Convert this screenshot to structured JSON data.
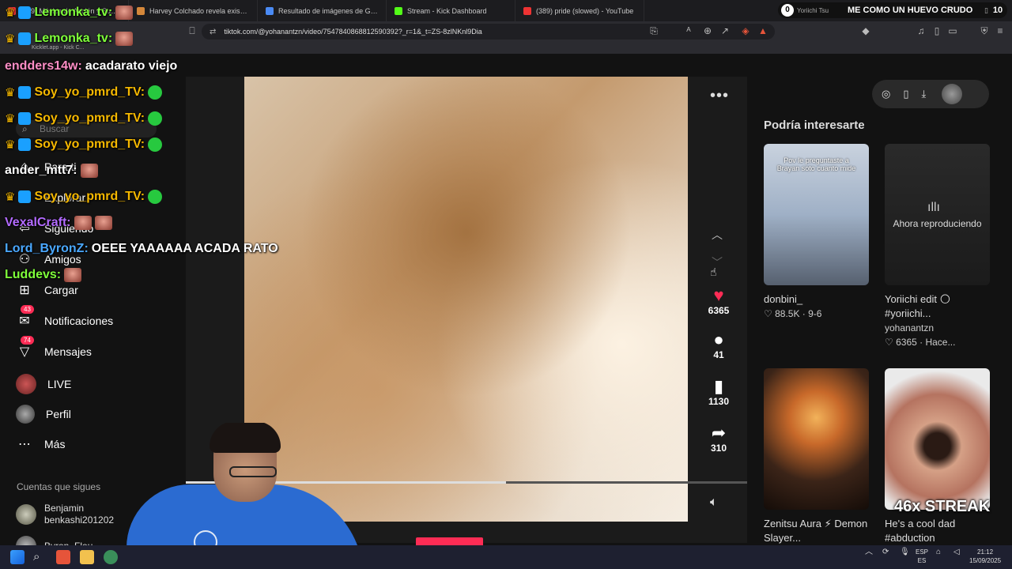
{
  "browser": {
    "tabs": [
      {
        "label": "(389) Música de Acción y Suspenso",
        "color": "#e33"
      },
      {
        "label": "Harvey Colchado revela existencia d",
        "color": "#d4873a"
      },
      {
        "label": "Resultado de imágenes de Google",
        "color": "#4a8af4"
      },
      {
        "label": "Stream - Kick Dashboard",
        "color": "#53fc18"
      },
      {
        "label": "(389) pride (slowed) - YouTube",
        "color": "#e33"
      },
      {
        "label": "Yoriichi Tsu",
        "color": "#ddd"
      }
    ],
    "tab_count": "10",
    "url": "tiktok.com/@yohanantzn/video/7547840868812590392?_r=1&_t=ZS-8zlNKnl9Dia",
    "bookmark": "Kicklet.app - Kick C..."
  },
  "overlay_banner": {
    "left_num": "0",
    "text": "ME COMO UN HUEVO CRUDO",
    "right_num": "10"
  },
  "sidebar": {
    "search_placeholder": "Buscar",
    "items": [
      {
        "label": "Para ti",
        "icon": "home-icon"
      },
      {
        "label": "Explorar",
        "icon": "compass-icon"
      },
      {
        "label": "Siguiendo",
        "icon": "following-icon"
      },
      {
        "label": "Amigos",
        "icon": "friends-icon"
      },
      {
        "label": "Cargar",
        "icon": "upload-icon"
      },
      {
        "label": "Notificaciones",
        "icon": "bell-icon",
        "badge": "43"
      },
      {
        "label": "Mensajes",
        "icon": "paper-plane-icon",
        "badge": "74"
      },
      {
        "label": "LIVE",
        "icon": "live-icon"
      },
      {
        "label": "Perfil",
        "icon": "profile-icon"
      },
      {
        "label": "Más",
        "icon": "more-icon"
      }
    ],
    "following_title": "Cuentas que sigues",
    "following": [
      {
        "name": "Benjamin",
        "handle": "benkashi201202"
      },
      {
        "name": "Byron_Flou",
        "handle": ""
      }
    ]
  },
  "video": {
    "likes": "6365",
    "comments": "41",
    "saves": "1130",
    "shares": "310",
    "progress": 0.57
  },
  "suggestions": {
    "title": "Podría interesarte",
    "items": [
      {
        "caption_top": "Pov le preguntaste a Brayan soto cuanto mide",
        "author": "donbini_",
        "stats": "♡ 88.5K · 9-6",
        "title": ""
      },
      {
        "caption_top": "Ahora reproduciendo",
        "title": "Yoriichi edit 🌕 #yoriichi...",
        "author": "yohanantzn",
        "stats": "♡ 6365 · Hace..."
      },
      {
        "title": "Zenitsu Aura ⚡ Demon Slayer...",
        "author": "",
        "stats": ""
      },
      {
        "title": "He's a cool dad #abduction",
        "author": "",
        "stats": ""
      }
    ],
    "streak": "46x STREAK"
  },
  "chat": [
    {
      "user": "Lemonka_tv:",
      "color": "#7fff3a",
      "msg": "",
      "emotes": [
        "face"
      ]
    },
    {
      "user": "Lemonka_tv:",
      "color": "#7fff3a",
      "msg": "",
      "emotes": [
        "face"
      ]
    },
    {
      "user": "endders14w:",
      "color": "#ff8ec6",
      "msg": "acadarato viejo",
      "emotes": []
    },
    {
      "user": "Soy_yo_pmrd_TV:",
      "color": "#f5b800",
      "msg": "",
      "emotes": [
        "green"
      ]
    },
    {
      "user": "Soy_yo_pmrd_TV:",
      "color": "#f5b800",
      "msg": "",
      "emotes": [
        "green"
      ]
    },
    {
      "user": "Soy_yo_pmrd_TV:",
      "color": "#f5b800",
      "msg": "",
      "emotes": [
        "green"
      ]
    },
    {
      "user": "ander_mtt7:",
      "color": "#ffffff",
      "msg": "",
      "emotes": [
        "face"
      ]
    },
    {
      "user": "Soy_yo_pmrd_TV:",
      "color": "#f5b800",
      "msg": "",
      "emotes": [
        "green"
      ]
    },
    {
      "user": "VexalCraft:",
      "color": "#b36bff",
      "msg": "",
      "emotes": [
        "face",
        "face"
      ]
    },
    {
      "user": "Lord_ByronZ:",
      "color": "#4aa8ff",
      "msg": "OEEE YAAAAAA ACADA RATO",
      "emotes": []
    },
    {
      "user": "Luddevs:",
      "color": "#7fff3a",
      "msg": "",
      "emotes": [
        "face"
      ]
    }
  ],
  "taskbar": {
    "lang_top": "ESP",
    "lang_bottom": "ES",
    "time": "21:12",
    "date": "15/09/2025"
  }
}
